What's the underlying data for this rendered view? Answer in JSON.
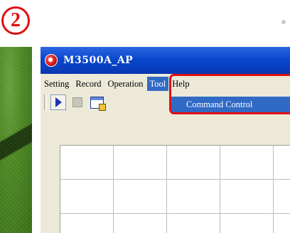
{
  "step": {
    "number": "2"
  },
  "window": {
    "title": "M3500A_AP",
    "menu": [
      "Setting",
      "Record",
      "Operation",
      "Tool",
      "Help"
    ],
    "active_menu": "Tool",
    "dropdown": {
      "items": [
        "Command Control"
      ]
    },
    "toolbar": {
      "buttons": [
        "play-icon",
        "stop-icon",
        "command-control-icon"
      ]
    }
  },
  "colors": {
    "highlight": "#e01010",
    "titlebar": "#0a47cf",
    "menu_selected": "#316ac5"
  }
}
